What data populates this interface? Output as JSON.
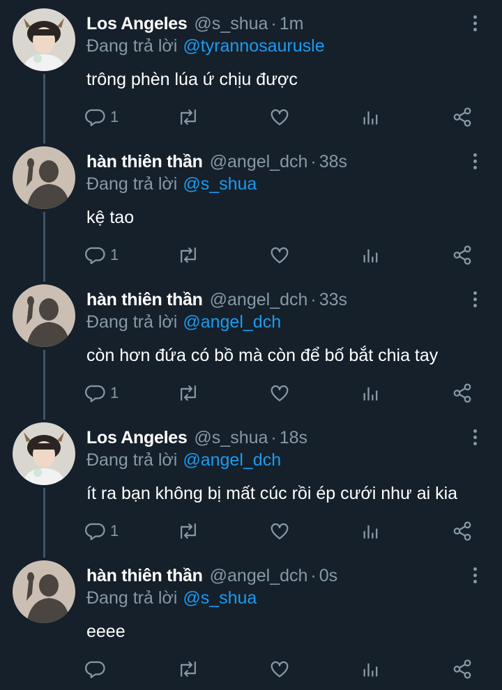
{
  "tweets": [
    {
      "name": "Los Angeles",
      "handle": "@s_shua",
      "sep": "·",
      "time": "1m",
      "reply_prefix": "Đang trả lời",
      "reply_to": "@tyrannosaurusle",
      "text": "trông phèn lúa ứ chịu được",
      "reply_count": "1",
      "avatar": "shua-avatar"
    },
    {
      "name": "hàn thiên thần",
      "handle": "@angel_dch",
      "sep": "·",
      "time": "38s",
      "reply_prefix": "Đang trả lời",
      "reply_to": "@s_shua",
      "text": "kệ tao",
      "reply_count": "1",
      "avatar": "angel-avatar"
    },
    {
      "name": "hàn thiên thần",
      "handle": "@angel_dch",
      "sep": "·",
      "time": "33s",
      "reply_prefix": "Đang trả lời",
      "reply_to": "@angel_dch",
      "text": "còn hơn đứa có bồ mà còn để bố bắt chia tay",
      "reply_count": "1",
      "avatar": "angel-avatar"
    },
    {
      "name": "Los Angeles",
      "handle": "@s_shua",
      "sep": "·",
      "time": "18s",
      "reply_prefix": "Đang trả lời",
      "reply_to": "@angel_dch",
      "text": "ít ra bạn không bị mất cúc rồi ép cưới như ai kia",
      "reply_count": "1",
      "avatar": "shua-avatar"
    },
    {
      "name": "hàn thiên thần",
      "handle": "@angel_dch",
      "sep": "·",
      "time": "0s",
      "reply_prefix": "Đang trả lời",
      "reply_to": "@s_shua",
      "text": "eeee",
      "reply_count": "",
      "avatar": "angel-avatar"
    }
  ],
  "icons": {
    "reply": "reply-icon",
    "retweet": "retweet-icon",
    "like": "heart-icon",
    "views": "analytics-icon",
    "share": "share-icon",
    "more": "more-vertical-icon"
  },
  "colors": {
    "background": "#15202b",
    "text": "#ffffff",
    "secondary": "#8899a6",
    "mention": "#1d9bf0",
    "thread_line": "#3d5466"
  }
}
